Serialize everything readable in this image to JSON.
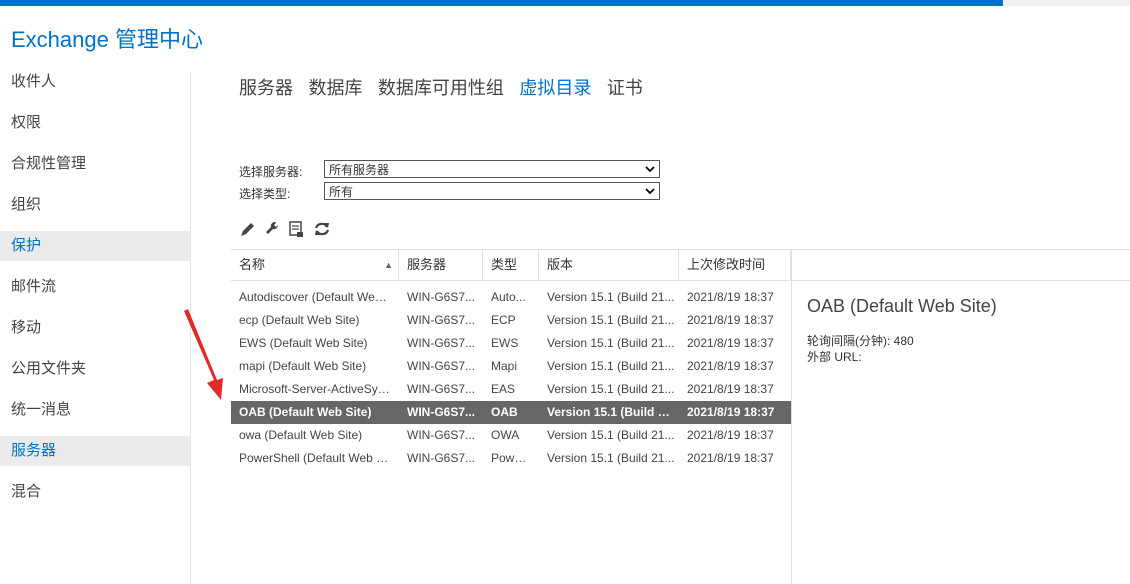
{
  "app": {
    "title": "Exchange 管理中心"
  },
  "sidebar": {
    "items": [
      {
        "label": "收件人",
        "selected": false
      },
      {
        "label": "权限",
        "selected": false
      },
      {
        "label": "合规性管理",
        "selected": false
      },
      {
        "label": "组织",
        "selected": false
      },
      {
        "label": "保护",
        "selected": true
      },
      {
        "label": "邮件流",
        "selected": false
      },
      {
        "label": "移动",
        "selected": false
      },
      {
        "label": "公用文件夹",
        "selected": false
      },
      {
        "label": "统一消息",
        "selected": false
      },
      {
        "label": "服务器",
        "selected": true
      },
      {
        "label": "混合",
        "selected": false
      }
    ]
  },
  "tabs": [
    {
      "label": "服务器",
      "active": false
    },
    {
      "label": "数据库",
      "active": false
    },
    {
      "label": "数据库可用性组",
      "active": false
    },
    {
      "label": "虚拟目录",
      "active": true
    },
    {
      "label": "证书",
      "active": false
    }
  ],
  "filters": {
    "server": {
      "label": "选择服务器:",
      "value": "所有服务器"
    },
    "type": {
      "label": "选择类型:",
      "value": "所有"
    }
  },
  "toolbar": {
    "icons": [
      "edit-icon",
      "wrench-icon",
      "reset-icon",
      "refresh-icon"
    ]
  },
  "table": {
    "columns": [
      "名称",
      "服务器",
      "类型",
      "版本",
      "上次修改时间"
    ],
    "sort_column": "名称",
    "rows": [
      {
        "name": "Autodiscover (Default Web...",
        "server": "WIN-G6S7...",
        "type": "Auto...",
        "version": "Version 15.1 (Build 21...",
        "modified": "2021/8/19 18:37",
        "selected": false
      },
      {
        "name": "ecp (Default Web Site)",
        "server": "WIN-G6S7...",
        "type": "ECP",
        "version": "Version 15.1 (Build 21...",
        "modified": "2021/8/19 18:37",
        "selected": false
      },
      {
        "name": "EWS (Default Web Site)",
        "server": "WIN-G6S7...",
        "type": "EWS",
        "version": "Version 15.1 (Build 21...",
        "modified": "2021/8/19 18:37",
        "selected": false
      },
      {
        "name": "mapi (Default Web Site)",
        "server": "WIN-G6S7...",
        "type": "Mapi",
        "version": "Version 15.1 (Build 21...",
        "modified": "2021/8/19 18:37",
        "selected": false
      },
      {
        "name": "Microsoft-Server-ActiveSyn...",
        "server": "WIN-G6S7...",
        "type": "EAS",
        "version": "Version 15.1 (Build 21...",
        "modified": "2021/8/19 18:37",
        "selected": false
      },
      {
        "name": "OAB (Default Web Site)",
        "server": "WIN-G6S7...",
        "type": "OAB",
        "version": "Version 15.1 (Build 21...",
        "modified": "2021/8/19 18:37",
        "selected": true
      },
      {
        "name": "owa (Default Web Site)",
        "server": "WIN-G6S7...",
        "type": "OWA",
        "version": "Version 15.1 (Build 21...",
        "modified": "2021/8/19 18:37",
        "selected": false
      },
      {
        "name": "PowerShell (Default Web Si...",
        "server": "WIN-G6S7...",
        "type": "Powe...",
        "version": "Version 15.1 (Build 21...",
        "modified": "2021/8/19 18:37",
        "selected": false
      }
    ]
  },
  "details": {
    "title": "OAB (Default Web Site)",
    "poll_interval": "轮询间隔(分钟): 480",
    "external_url": "外部 URL:"
  },
  "colors": {
    "accent": "#0072c6",
    "selected_row": "#666666",
    "arrow": "#e02a2a"
  }
}
